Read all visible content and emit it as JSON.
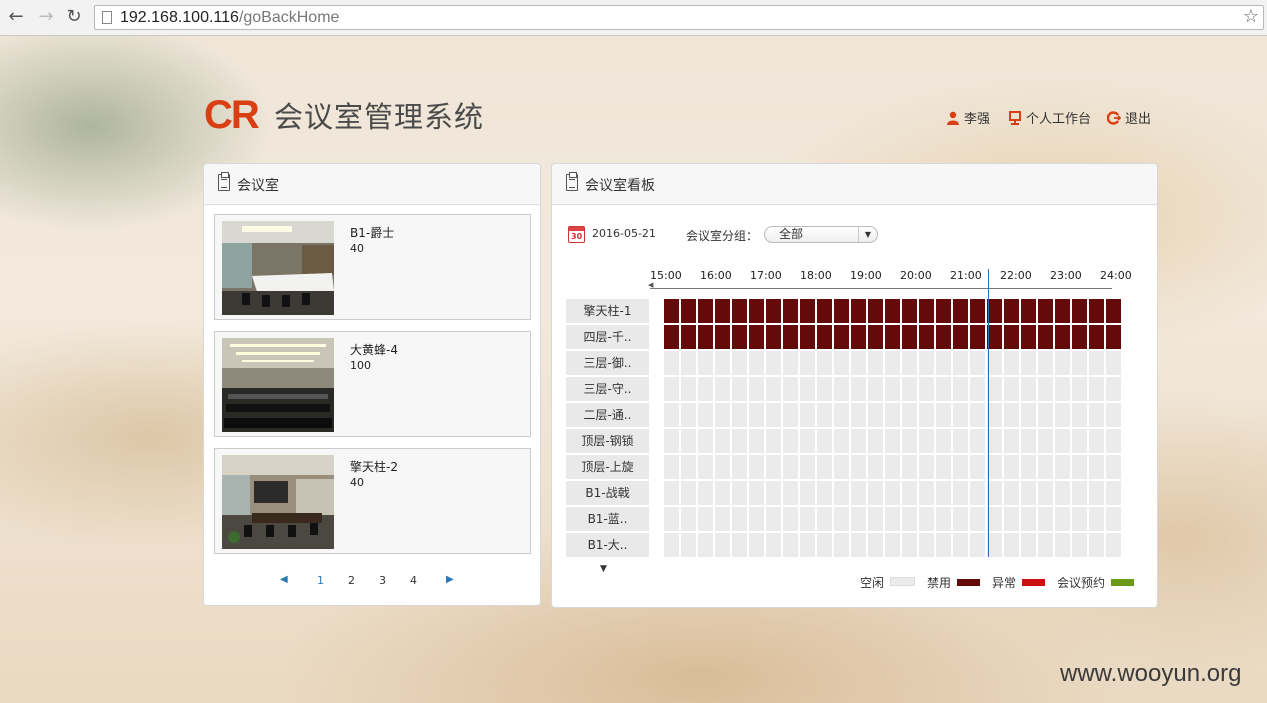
{
  "browser": {
    "url_host": "192.168.100.116",
    "url_path": "/goBackHome"
  },
  "header": {
    "logo_mark": "CR",
    "app_title": "会议室管理系统",
    "nav": [
      {
        "label": "李强",
        "icon": "user-icon"
      },
      {
        "label": "个人工作台",
        "icon": "monitor-icon"
      },
      {
        "label": "退出",
        "icon": "logout-icon"
      }
    ]
  },
  "colors": {
    "brand": "#d93f12",
    "idle": "#ebebeb",
    "disabled": "#650a0a",
    "abnormal": "#cc1111",
    "booked": "#6a9a18"
  },
  "rooms_panel": {
    "title": "会议室",
    "rooms": [
      {
        "name": "B1-爵士",
        "capacity": "40"
      },
      {
        "name": "大黄蜂-4",
        "capacity": "100"
      },
      {
        "name": "擎天柱-2",
        "capacity": "40"
      }
    ],
    "pages": [
      "1",
      "2",
      "3",
      "4"
    ],
    "current_page": 1
  },
  "board_panel": {
    "title": "会议室看板",
    "date": "2016-05-21",
    "calendar_day": "30",
    "group_label": "会议室分组：",
    "group_value": "全部",
    "time_labels": [
      "15:00",
      "16:00",
      "17:00",
      "18:00",
      "19:00",
      "20:00",
      "21:00",
      "22:00",
      "23:00",
      "24:00"
    ],
    "current_time": "21:30",
    "rows": [
      {
        "label": "擎天柱-1",
        "status": "disabled"
      },
      {
        "label": "四层-千..",
        "status": "disabled"
      },
      {
        "label": "三层-御..",
        "status": "idle"
      },
      {
        "label": "三层-守..",
        "status": "idle"
      },
      {
        "label": "二层-通..",
        "status": "idle"
      },
      {
        "label": "顶层-钢锁",
        "status": "idle"
      },
      {
        "label": "顶层-上旋",
        "status": "idle"
      },
      {
        "label": "B1-战戟",
        "status": "idle"
      },
      {
        "label": "B1-蓝..",
        "status": "idle"
      },
      {
        "label": "B1-大..",
        "status": "idle"
      }
    ],
    "legend": [
      {
        "label": "空闲",
        "status": "idle"
      },
      {
        "label": "禁用",
        "status": "disabled"
      },
      {
        "label": "异常",
        "status": "abnormal"
      },
      {
        "label": "会议预约",
        "status": "booked"
      }
    ]
  },
  "watermark": "www.wooyun.org"
}
